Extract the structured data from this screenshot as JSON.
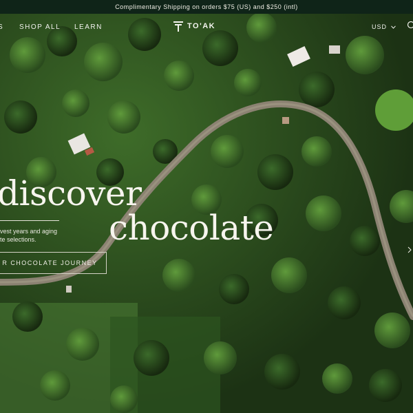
{
  "announcement": {
    "text": "Complimentary Shipping on orders $75 (US) and $250 (intl)"
  },
  "nav": {
    "items": [
      {
        "label": "S"
      },
      {
        "label": "SHOP ALL"
      },
      {
        "label": "LEARN"
      }
    ],
    "brand": "TO'AK",
    "currency": "USD"
  },
  "hero": {
    "headline_line1": "discover",
    "headline_line2": "chocolate",
    "subtext_line1": "vest years and aging",
    "subtext_line2": "te selections.",
    "cta_label": "R CHOCOLATE JOURNEY"
  },
  "icons": {
    "logo": "toak-logo-icon",
    "currency_caret": "chevron-down-icon",
    "search": "search-icon",
    "slider": "chevron-right-icon"
  },
  "colors": {
    "announce_bg": "#0f2418",
    "forest_dark": "#1f3517",
    "forest_mid": "#2f5a22",
    "forest_light": "#4e8a30",
    "road": "#8b8272",
    "text_light": "#f7f5ee"
  }
}
